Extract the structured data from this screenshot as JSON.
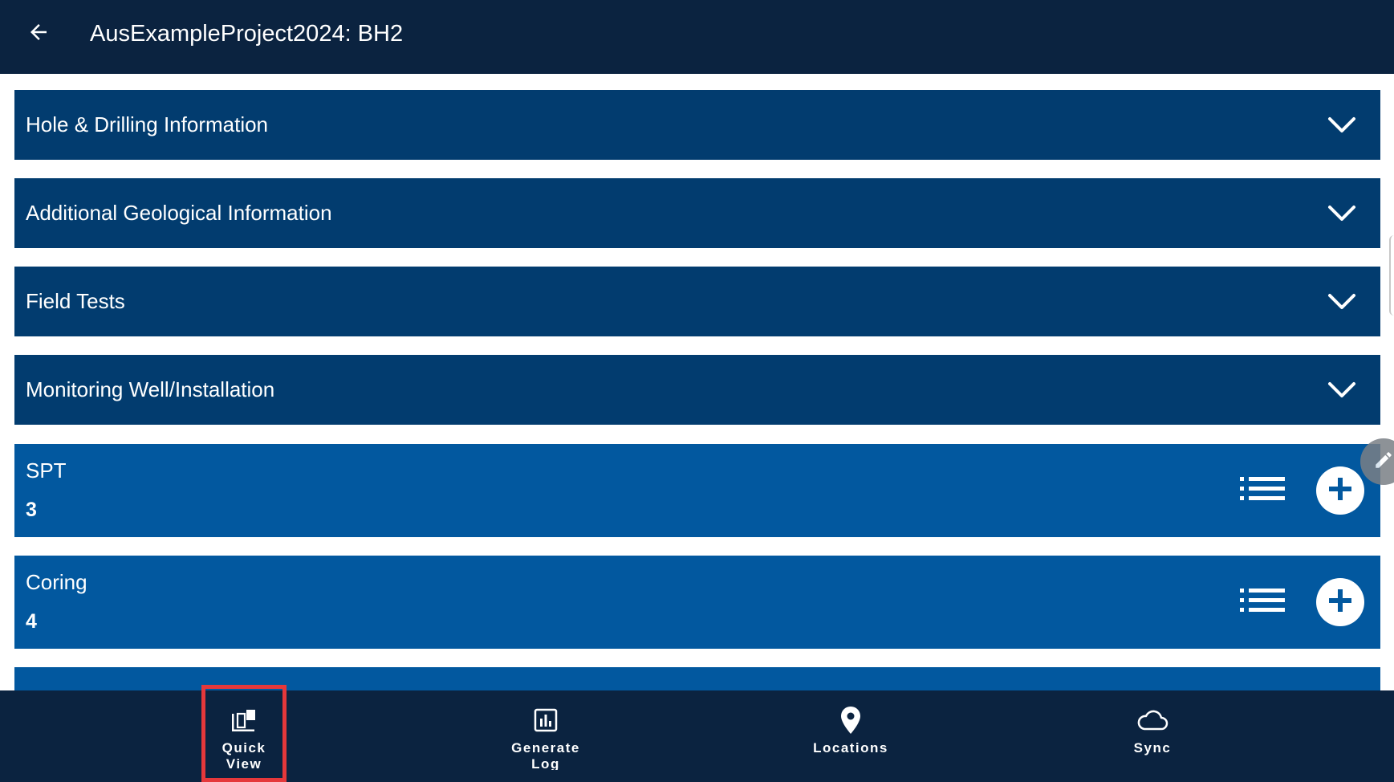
{
  "header": {
    "title": "AusExampleProject2024: BH2",
    "back_icon": "arrow-left-icon"
  },
  "sections": [
    {
      "label": "Hole & Drilling Information",
      "icon": "chevron-down-icon"
    },
    {
      "label": "Additional Geological Information",
      "icon": "chevron-down-icon"
    },
    {
      "label": "Field Tests",
      "icon": "chevron-down-icon"
    },
    {
      "label": "Monitoring Well/Installation",
      "icon": "chevron-down-icon"
    }
  ],
  "cards": [
    {
      "title": "SPT",
      "count": "3",
      "list_icon": "list-icon",
      "add_icon": "plus-icon"
    },
    {
      "title": "Coring",
      "count": "4",
      "list_icon": "list-icon",
      "add_icon": "plus-icon"
    }
  ],
  "bottom_nav": [
    {
      "label": "Quick View",
      "icon": "quick-view-icon",
      "selected": true
    },
    {
      "label": "Generate Log",
      "icon": "bar-chart-icon",
      "selected": false
    },
    {
      "label": "Locations",
      "icon": "map-pin-icon",
      "selected": false
    },
    {
      "label": "Sync",
      "icon": "cloud-icon",
      "selected": false
    }
  ],
  "colors": {
    "header_bg": "#0b2340",
    "section_bg": "#023c6f",
    "card_bg": "#02589f",
    "highlight": "#e5383b"
  }
}
